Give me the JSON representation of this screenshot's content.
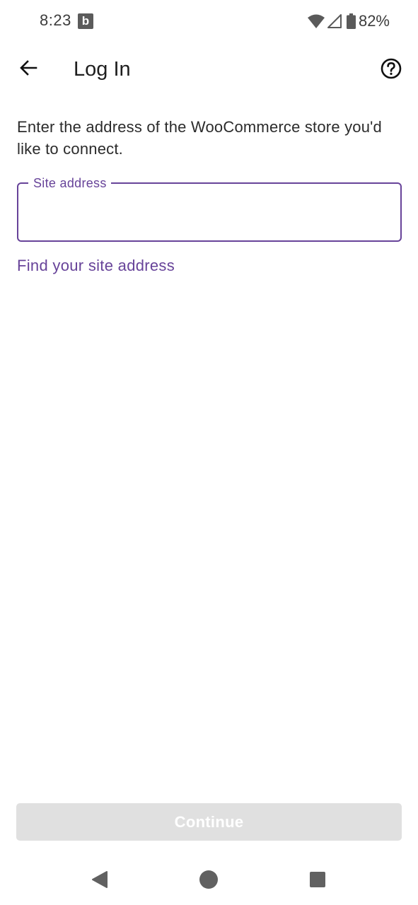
{
  "status_bar": {
    "time": "8:23",
    "notification_badge": "b",
    "battery_percent": "82%",
    "icons": [
      "wifi-icon",
      "signal-icon",
      "battery-icon"
    ]
  },
  "app_bar": {
    "title": "Log In",
    "back_icon": "arrow-left-icon",
    "help_icon": "help-circle-icon"
  },
  "content": {
    "instructions": "Enter the address of the WooCommerce store you'd like to connect.",
    "site_field": {
      "label": "Site address",
      "value": ""
    },
    "find_link": "Find your site address",
    "continue_label": "Continue"
  },
  "colors": {
    "accent": "#674399",
    "disabled_button": "#e0e0e0",
    "nav_icons": "#616161"
  }
}
